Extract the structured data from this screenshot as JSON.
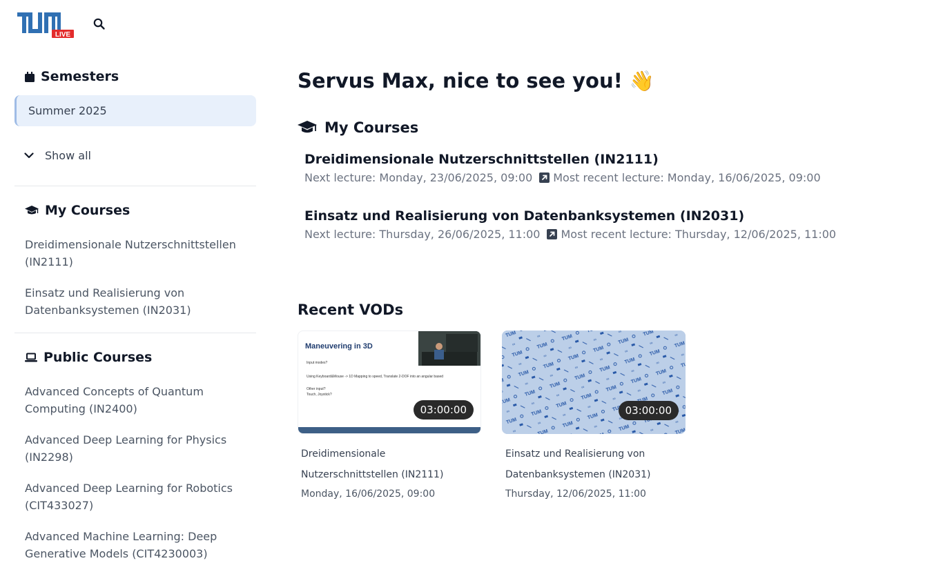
{
  "header": {
    "logo_text": "TUM",
    "logo_badge": "LIVE"
  },
  "sidebar": {
    "semesters_heading": "Semesters",
    "current_semester": "Summer 2025",
    "show_all_label": "Show all",
    "my_courses_heading": "My Courses",
    "my_courses": [
      "Dreidimensionale Nutzerschnittstellen (IN2111)",
      "Einsatz und Realisierung von Datenbanksystemen (IN2031)"
    ],
    "public_courses_heading": "Public Courses",
    "public_courses": [
      "Advanced Concepts of Quantum Computing (IN2400)",
      "Advanced Deep Learning for Physics (IN2298)",
      "Advanced Deep Learning for Robotics (CIT433027)",
      "Advanced Machine Learning: Deep Generative Models (CIT4230003)"
    ]
  },
  "main": {
    "greeting": "Servus Max, nice to see you! 👋",
    "my_courses_heading": "My Courses",
    "courses": [
      {
        "title": "Dreidimensionale Nutzerschnittstellen (IN2111)",
        "next_lecture": "Next lecture: Monday, 23/06/2025, 09:00",
        "recent_lecture": "Most recent lecture: Monday, 16/06/2025, 09:00"
      },
      {
        "title": "Einsatz und Realisierung von Datenbanksystemen (IN2031)",
        "next_lecture": "Next lecture: Thursday, 26/06/2025, 11:00",
        "recent_lecture": "Most recent lecture: Thursday, 12/06/2025, 11:00"
      }
    ],
    "recent_vods_heading": "Recent VODs",
    "vods": [
      {
        "slide_title": "Maneuvering in 3D",
        "slide_bullets": [
          "Input modes?",
          "Using Keyboard&Mouse -> 1D Mapping to speed, Translate 2-DOF into an angular based",
          "Other input?",
          "Touch, Joystick?"
        ],
        "duration": "03:00:00",
        "title_line1": "Dreidimensionale",
        "title_line2": "Nutzerschnittstellen (IN2111)",
        "date": "Monday, 16/06/2025, 09:00"
      },
      {
        "duration": "03:00:00",
        "title_line1": "Einsatz und Realisierung von",
        "title_line2": "Datenbanksystemen (IN2031)",
        "date": "Thursday, 12/06/2025, 11:00"
      }
    ]
  },
  "colors": {
    "tum_blue": "#3070b3",
    "live_red": "#e32b2b",
    "semester_bg": "#e8f0fb",
    "pattern_bg": "#b9cce6"
  }
}
